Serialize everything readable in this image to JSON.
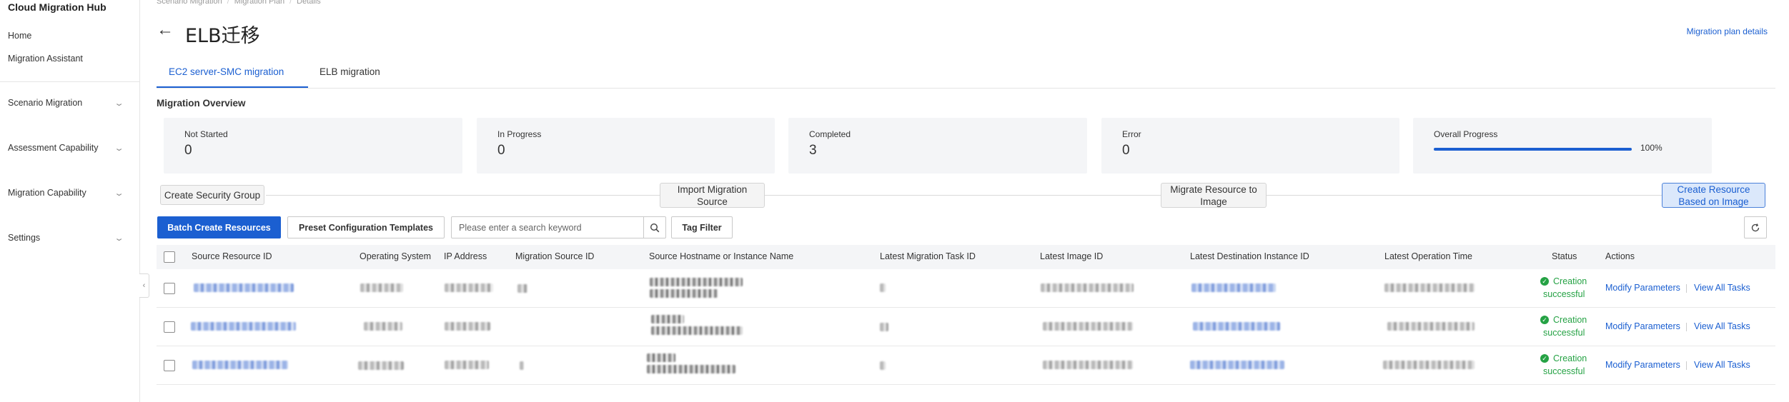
{
  "sidebar": {
    "brand": "Cloud Migration Hub",
    "links": [
      "Home",
      "Migration Assistant"
    ],
    "groups": [
      "Scenario Migration",
      "Assessment Capability",
      "Migration Capability",
      "Settings"
    ]
  },
  "breadcrumb": [
    "Scenario Migration",
    "Migration Plan",
    "Details"
  ],
  "header": {
    "title": "ELB迁移",
    "details_link": "Migration plan details"
  },
  "tabs": [
    {
      "label": "EC2 server-SMC migration",
      "active": true
    },
    {
      "label": "ELB migration",
      "active": false
    }
  ],
  "overview": {
    "title": "Migration Overview",
    "cards": [
      {
        "label": "Not Started",
        "value": "0"
      },
      {
        "label": "In Progress",
        "value": "0"
      },
      {
        "label": "Completed",
        "value": "3"
      },
      {
        "label": "Error",
        "value": "0"
      }
    ],
    "progress": {
      "label": "Overall Progress",
      "percent": 100,
      "text": "100%"
    }
  },
  "steps": [
    {
      "label": "Create Security Group",
      "active": false
    },
    {
      "label": "Import Migration Source",
      "active": false
    },
    {
      "label": "Migrate Resource to Image",
      "active": false
    },
    {
      "label": "Create Resource Based on Image",
      "active": true
    }
  ],
  "toolbar": {
    "batch_create": "Batch Create Resources",
    "preset_templates": "Preset Configuration Templates",
    "search_placeholder": "Please enter a search keyword",
    "tag_filter": "Tag Filter"
  },
  "table": {
    "columns": [
      "Source Resource ID",
      "Operating System",
      "IP Address",
      "Migration Source ID",
      "Source Hostname or Instance Name",
      "Latest Migration Task ID",
      "Latest Image ID",
      "Latest Destination Instance ID",
      "Latest Operation Time",
      "Status",
      "Actions"
    ],
    "rows": [
      {
        "status_line1": "Creation",
        "status_line2": "successful",
        "action1": "Modify Parameters",
        "action2": "View All Tasks"
      },
      {
        "status_line1": "Creation",
        "status_line2": "successful",
        "action1": "Modify Parameters",
        "action2": "View All Tasks"
      },
      {
        "status_line1": "Creation",
        "status_line2": "successful",
        "action1": "Modify Parameters",
        "action2": "View All Tasks"
      }
    ]
  },
  "colors": {
    "accent": "#1b5fd1",
    "success": "#25a244",
    "card_bg": "#f4f5f7"
  },
  "icons": [
    "back-arrow-icon",
    "chevron-down-icon",
    "search-icon",
    "refresh-icon",
    "check-circle-icon",
    "collapse-sidebar-icon"
  ]
}
